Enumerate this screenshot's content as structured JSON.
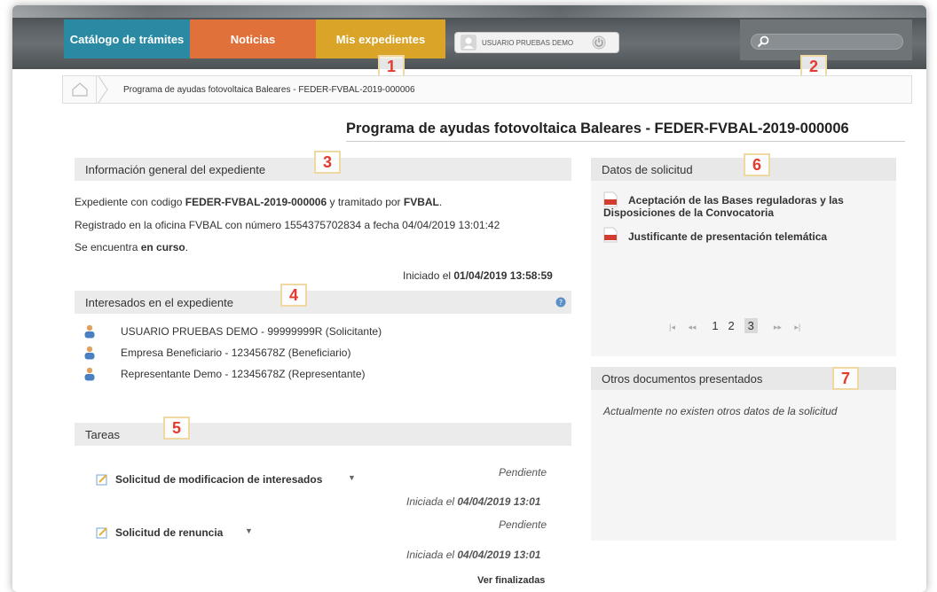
{
  "nav": {
    "tabs": [
      {
        "label": "Catálogo de trámites",
        "color": "#2b8aa3"
      },
      {
        "label": "Noticias",
        "color": "#e0713a"
      },
      {
        "label": "Mis expedientes",
        "color": "#d9a428"
      }
    ],
    "user_label": "USUARIO PRUEBAS DEMO"
  },
  "search": {
    "placeholder": ""
  },
  "annotations": [
    "1",
    "2",
    "3",
    "4",
    "5",
    "6",
    "7"
  ],
  "breadcrumb": {
    "current": "Programa de ayudas fotovoltaica Baleares - FEDER-FVBAL-2019-000006"
  },
  "page_title": "Programa de ayudas fotovoltaica Baleares - FEDER-FVBAL-2019-000006",
  "info_general": {
    "header": "Información general del expediente",
    "line1_prefix": "Expediente con codigo ",
    "line1_code": "FEDER-FVBAL-2019-000006",
    "line1_mid": " y tramitado por ",
    "line1_org": "FVBAL",
    "line1_suffix": ".",
    "line2": "Registrado en la oficina FVBAL con número 1554375702834 a fecha 04/04/2019 13:01:42",
    "line3_prefix": "Se encuentra ",
    "line3_status": "en curso",
    "line3_suffix": ".",
    "started_prefix": "Iniciado el ",
    "started_date": "01/04/2019 13:58:59"
  },
  "interesados": {
    "header": "Interesados en el expediente",
    "items": [
      "USUARIO PRUEBAS DEMO - 99999999R (Solicitante)",
      "Empresa Beneficiario - 12345678Z (Beneficiario)",
      "Representante Demo - 12345678Z (Representante)"
    ]
  },
  "tareas": {
    "header": "Tareas",
    "items": [
      {
        "name": "Solicitud de modificacion de interesados",
        "status": "Pendiente",
        "started_prefix": "Iniciada el ",
        "started_date": "04/04/2019 13:01"
      },
      {
        "name": "Solicitud de renuncia",
        "status": "Pendiente",
        "started_prefix": "Iniciada el ",
        "started_date": "04/04/2019 13:01"
      }
    ],
    "ver_finalizadas": "Ver finalizadas"
  },
  "datos_solicitud": {
    "header": "Datos de solicitud",
    "docs": [
      {
        "line1": "Aceptación de las Bases reguladoras y las",
        "line2": "Disposiciones de la Convocatoria"
      },
      {
        "line1": "Justificante de presentación telemática",
        "line2": ""
      }
    ],
    "pager": {
      "first": "|◂",
      "prev": "◂◂",
      "pages": [
        "1",
        "2",
        "3"
      ],
      "current": "3",
      "next": "▸▸",
      "last": "▸|"
    }
  },
  "otros_documentos": {
    "header": "Otros documentos presentados",
    "empty_text": "Actualmente no existen otros datos de la solicitud"
  },
  "colors": {
    "accent_red": "#e53a2e",
    "pdf_red": "#d23b2e"
  }
}
